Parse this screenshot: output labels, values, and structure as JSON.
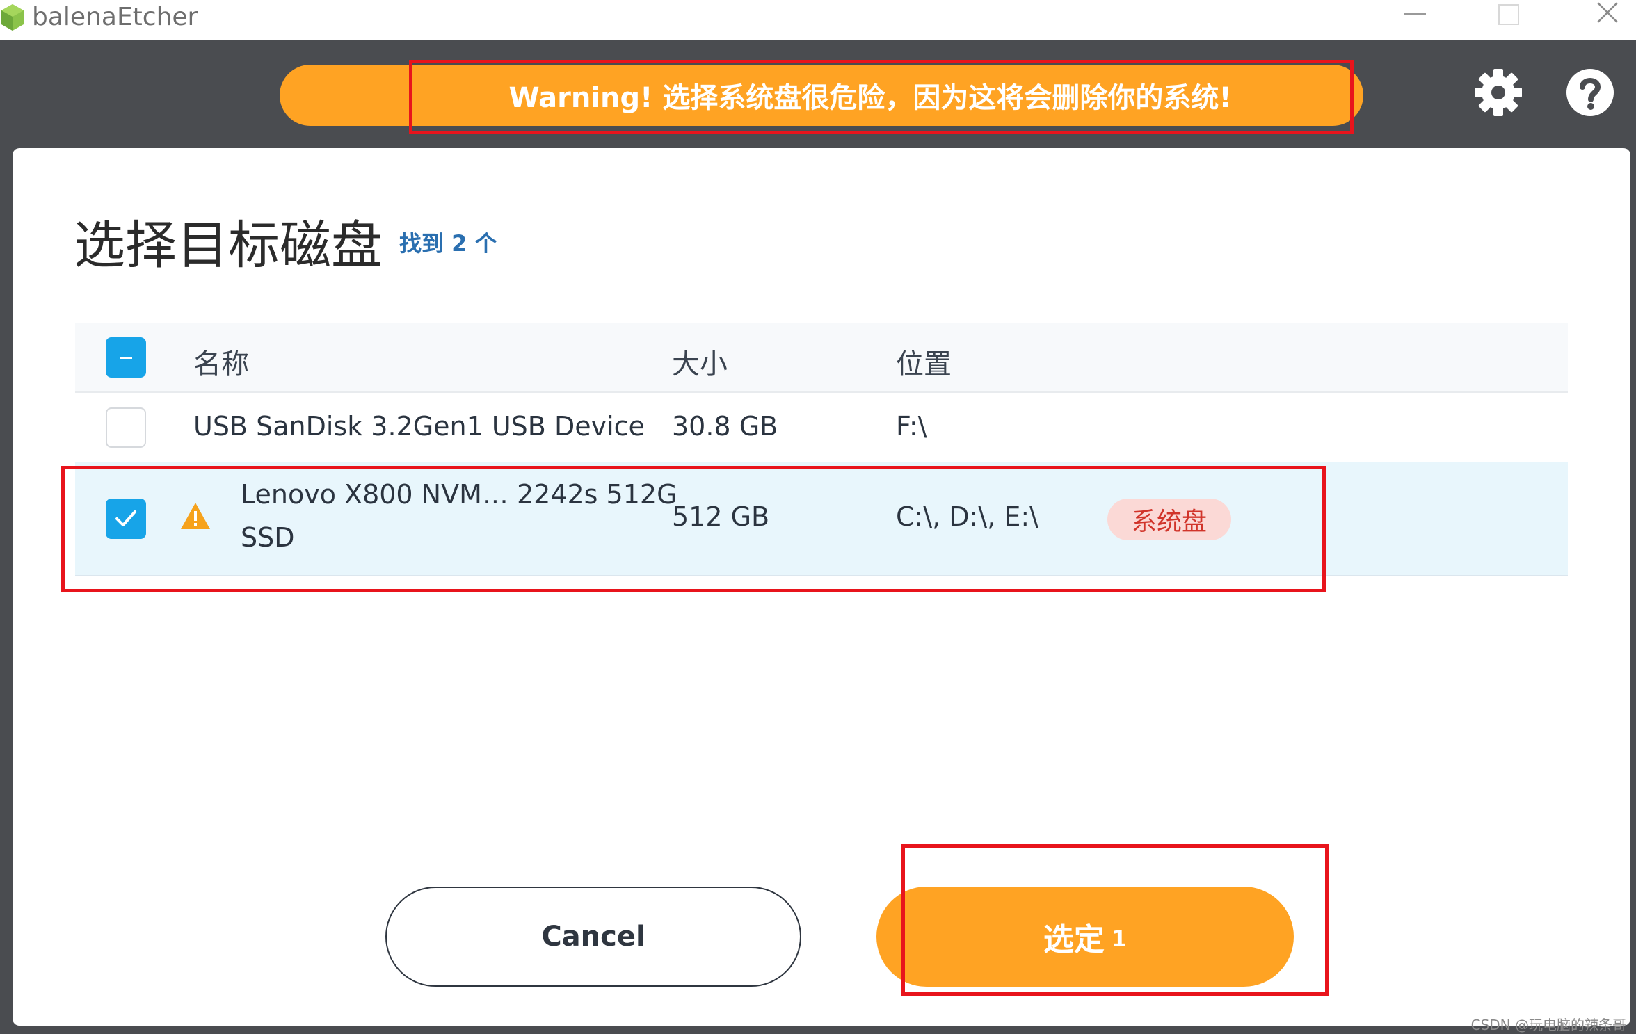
{
  "window": {
    "title": "balenaEtcher"
  },
  "header": {
    "warning_text": "Warning! 选择系统盘很危险，因为这将会删除你的系统!",
    "accent_color": "#ffa323",
    "settings_icon": "gear-icon",
    "help_icon": "help-icon"
  },
  "modal": {
    "title": "选择目标磁盘",
    "found": "找到 2 个"
  },
  "table": {
    "columns": [
      "名称",
      "大小",
      "位置"
    ],
    "rows": [
      {
        "checked": false,
        "name": "USB SanDisk 3.2Gen1 USB Device",
        "size": "30.8 GB",
        "location": "F:\\"
      },
      {
        "checked": true,
        "warning": true,
        "name_line1": "Lenovo X800 NVM… 2242s 512G",
        "name_line2": "SSD",
        "size": "512 GB",
        "location": "C:\\, D:\\, E:\\",
        "badge": "系统盘"
      }
    ]
  },
  "buttons": {
    "cancel": "Cancel",
    "select": "选定",
    "select_count": "1"
  },
  "watermark": "CSDN @玩电脑的辣条哥"
}
